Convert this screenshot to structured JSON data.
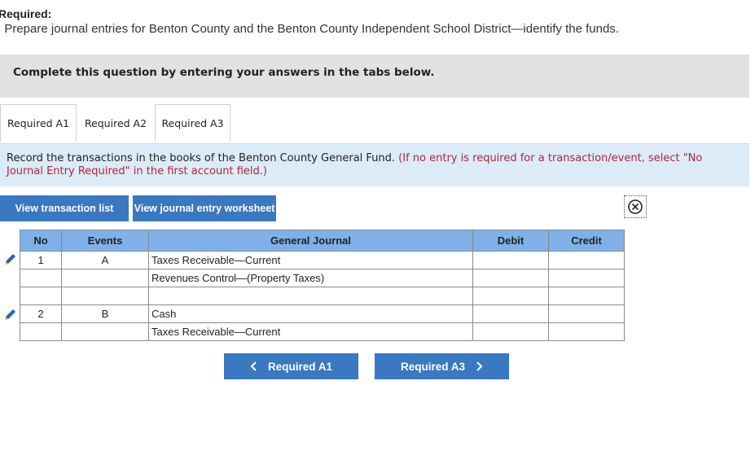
{
  "header": {
    "title": "Required:",
    "text": ". Prepare journal entries for Benton County and the Benton County Independent School District—identify the funds."
  },
  "banner": {
    "text": "Complete this question by entering your answers in the tabs below."
  },
  "tabs": [
    {
      "label": "Required A1"
    },
    {
      "label": "Required A2"
    },
    {
      "label": "Required A3"
    }
  ],
  "instructions": {
    "main": "Record the transactions in the books of the Benton County General Fund. ",
    "note": "(If no entry is required for a transaction/event, select \"No Journal Entry Required\" in the first account field.)"
  },
  "buttons": {
    "view_transactions": "View transaction list",
    "view_worksheet": "View journal entry worksheet"
  },
  "table": {
    "headers": {
      "no": "No",
      "events": "Events",
      "journal": "General Journal",
      "debit": "Debit",
      "credit": "Credit"
    },
    "rows": [
      {
        "no": "1",
        "event": "A",
        "account": "Taxes Receivable—Current",
        "debit": "",
        "credit": ""
      },
      {
        "no": "",
        "event": "",
        "account": "Revenues Control—(Property Taxes)",
        "debit": "",
        "credit": ""
      },
      {
        "no": "",
        "event": "",
        "account": "",
        "debit": "",
        "credit": ""
      },
      {
        "no": "2",
        "event": "B",
        "account": "Cash",
        "debit": "",
        "credit": ""
      },
      {
        "no": "",
        "event": "",
        "account": "Taxes Receivable—Current",
        "debit": "",
        "credit": ""
      }
    ]
  },
  "nav": {
    "prev": "Required A1",
    "next": "Required A3"
  },
  "colors": {
    "accent": "#3a78c2",
    "header_blue": "#7fb0e8",
    "note_red": "#b3233b"
  }
}
